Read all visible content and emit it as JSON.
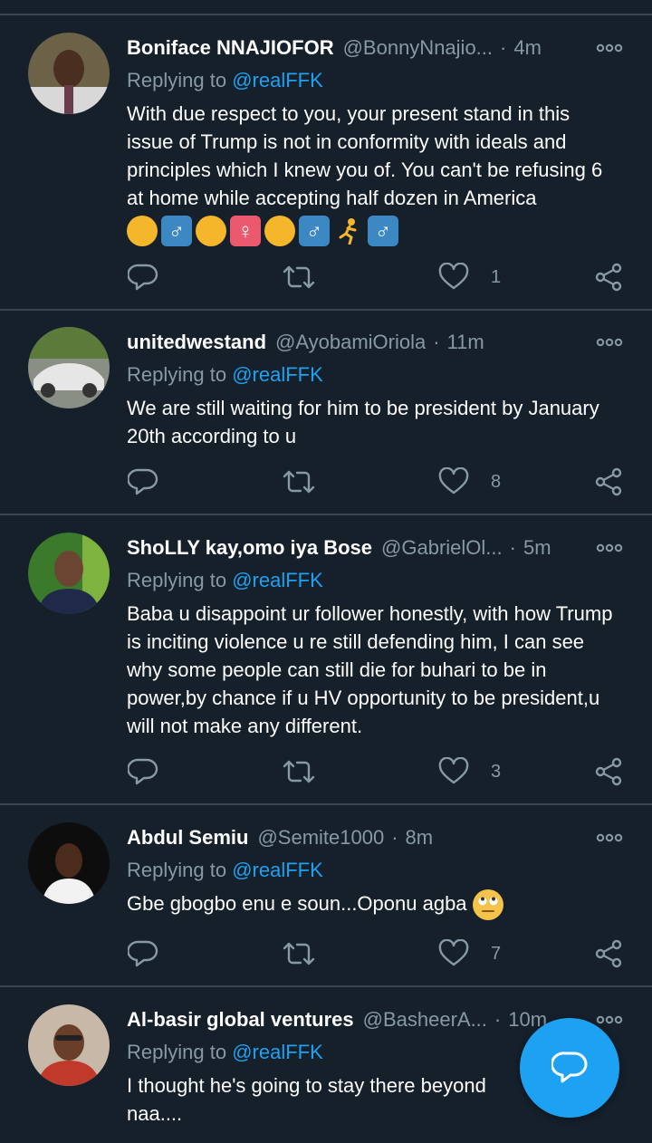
{
  "tweets": [
    {
      "name": "Boniface NNAJIOFOR",
      "handle": "@BonnyNnajio...",
      "time": "4m",
      "replying_prefix": "Replying to",
      "replying_to": "@realFFK",
      "text": "With due respect to you, your present stand in this issue of Trump is not in conformity with ideals and principles which I knew you of. You can't be refusing 6 at home while accepting half dozen in America",
      "emoji_row": [
        "person",
        "male",
        "person",
        "female",
        "person",
        "male",
        "person",
        "male"
      ],
      "likes": "1"
    },
    {
      "name": "unitedwestand",
      "handle": "@AyobamiOriola",
      "time": "11m",
      "replying_prefix": "Replying to",
      "replying_to": "@realFFK",
      "text": "We are still waiting for him to be president by January 20th according to u",
      "likes": "8"
    },
    {
      "name": "ShoLLY kay,omo iya Bose",
      "handle": "@GabrielOl...",
      "time": "5m",
      "replying_prefix": "Replying to",
      "replying_to": "@realFFK",
      "text": "Baba u disappoint ur follower honestly, with how Trump is inciting violence u re still defending him, I can see why some people can still die for buhari to be in power,by chance if u HV opportunity to be president,u will not make any different.",
      "likes": "3"
    },
    {
      "name": "Abdul Semiu",
      "handle": "@Semite1000",
      "time": "8m",
      "replying_prefix": "Replying to",
      "replying_to": "@realFFK",
      "text": "Gbe gbogbo enu e soun...Oponu agba",
      "trailing_emoji": "eye-roll",
      "likes": "7"
    },
    {
      "name": "Al-basir global ventures",
      "handle": "@BasheerA...",
      "time": "10m",
      "replying_prefix": "Replying to",
      "replying_to": "@realFFK",
      "text": "I thought he's going to stay there beyond ",
      "text_hidden_tail": "0",
      "text_line2": "naa...."
    }
  ],
  "separator": "·",
  "icons": {
    "more": "more-dots-icon",
    "reply": "reply-icon",
    "retweet": "retweet-icon",
    "like": "heart-icon",
    "share": "share-icon",
    "compose": "compose-reply-icon"
  },
  "colors": {
    "background": "#15202b",
    "divider": "#38444d",
    "accent": "#1da1f2",
    "muted": "#8899a6",
    "text": "#ffffff"
  }
}
